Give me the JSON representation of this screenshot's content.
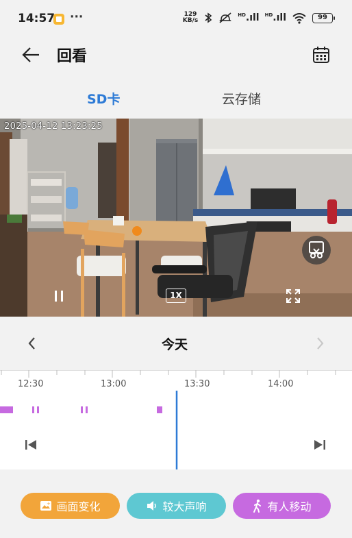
{
  "status_bar": {
    "time": "14:57",
    "overflow": "···",
    "net_speed_value": "129",
    "net_speed_unit": "KB/s",
    "signal_tag": "HD",
    "battery": "99",
    "icons": [
      "app-notification-icon",
      "bluetooth-icon",
      "mute-icon",
      "signal-icon",
      "wifi-icon",
      "battery-icon"
    ]
  },
  "header": {
    "title": "回看"
  },
  "tabs": [
    {
      "label": "SD卡",
      "active": true
    },
    {
      "label": "云存储",
      "active": false
    }
  ],
  "video": {
    "timestamp": "2025-04-12 13:23:25",
    "speed": "1X"
  },
  "date_nav": {
    "label": "今天"
  },
  "timeline": {
    "ticks": [
      "12:30",
      "13:00",
      "13:30",
      "14:00"
    ],
    "event_color": "#c66ae0",
    "cursor_color": "#2e7bd6"
  },
  "filters": [
    {
      "label": "画面变化",
      "color": "#f2a53a",
      "icon": "image-change-icon"
    },
    {
      "label": "较大声响",
      "color": "#5ec8d2",
      "icon": "speaker-icon"
    },
    {
      "label": "有人移动",
      "color": "#c66ae0",
      "icon": "walking-person-icon"
    }
  ]
}
